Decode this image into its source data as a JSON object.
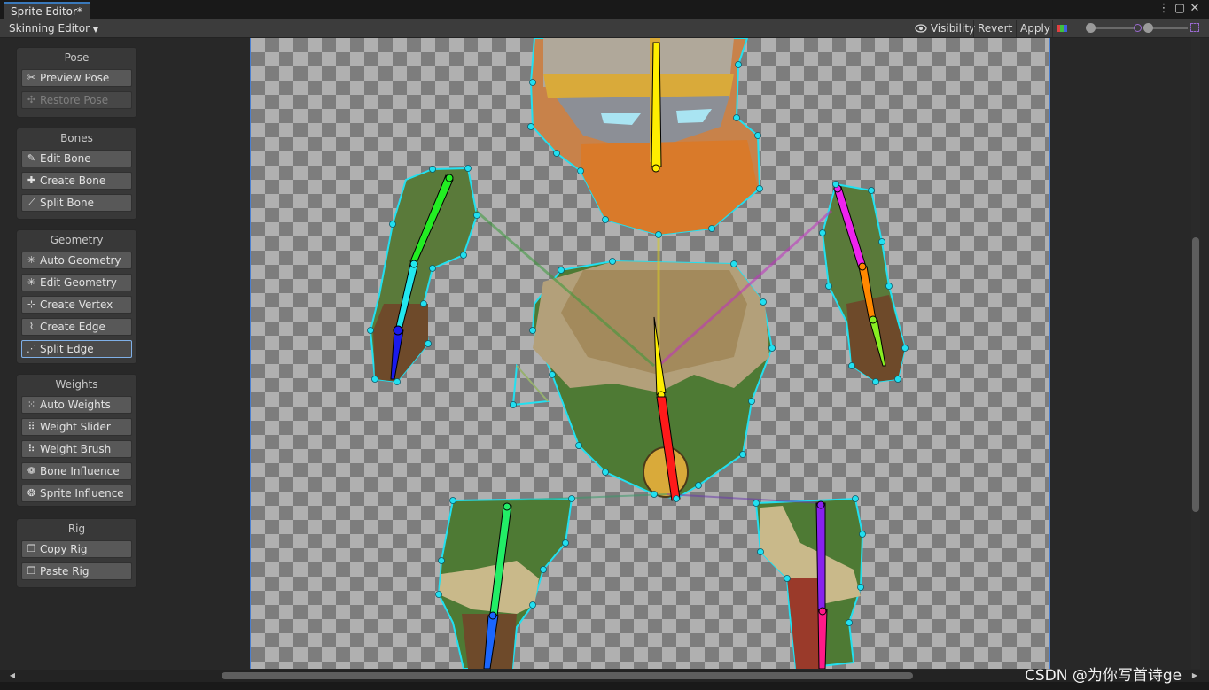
{
  "window": {
    "tab_title": "Sprite Editor*",
    "menu_icon": "kebab-icon",
    "maximize_icon": "maximize-icon",
    "close_icon": "close-icon"
  },
  "toolbar": {
    "mode_dropdown": "Skinning Editor",
    "visibility": "Visibility",
    "revert": "Revert",
    "apply": "Apply"
  },
  "side_panel": {
    "pose": {
      "title": "Pose",
      "buttons": [
        {
          "label": "Preview Pose",
          "icon": "preview-pose-icon",
          "enabled": true
        },
        {
          "label": "Restore Pose",
          "icon": "restore-pose-icon",
          "enabled": false
        }
      ]
    },
    "bones": {
      "title": "Bones",
      "buttons": [
        {
          "label": "Edit Bone",
          "icon": "edit-bone-icon"
        },
        {
          "label": "Create Bone",
          "icon": "create-bone-icon"
        },
        {
          "label": "Split Bone",
          "icon": "split-bone-icon"
        }
      ]
    },
    "geometry": {
      "title": "Geometry",
      "buttons": [
        {
          "label": "Auto Geometry",
          "icon": "auto-geometry-icon"
        },
        {
          "label": "Edit Geometry",
          "icon": "edit-geometry-icon"
        },
        {
          "label": "Create Vertex",
          "icon": "create-vertex-icon"
        },
        {
          "label": "Create Edge",
          "icon": "create-edge-icon"
        },
        {
          "label": "Split Edge",
          "icon": "split-edge-icon",
          "active": true
        }
      ]
    },
    "weights": {
      "title": "Weights",
      "buttons": [
        {
          "label": "Auto Weights",
          "icon": "auto-weights-icon"
        },
        {
          "label": "Weight Slider",
          "icon": "weight-slider-icon"
        },
        {
          "label": "Weight Brush",
          "icon": "weight-brush-icon"
        },
        {
          "label": "Bone Influence",
          "icon": "bone-influence-icon"
        },
        {
          "label": "Sprite Influence",
          "icon": "sprite-influence-icon"
        }
      ]
    },
    "rig": {
      "title": "Rig",
      "buttons": [
        {
          "label": "Copy Rig",
          "icon": "copy-rig-icon"
        },
        {
          "label": "Paste Rig",
          "icon": "paste-rig-icon"
        }
      ]
    }
  },
  "watermark": "CSDN @为你写首诗ge",
  "colors": {
    "mesh_outline": "#22e0f0",
    "bone_head": "#ffee00",
    "bone_torso_lower": "#ff1a1a",
    "bone_left_upper_arm": "#22ee22",
    "bone_left_forearm": "#22e8ee",
    "bone_left_hand": "#1a1aee",
    "bone_right_upper_arm": "#ee22ee",
    "bone_right_forearm": "#ff8800",
    "bone_right_hand": "#88ee22",
    "bone_left_thigh": "#22ee66",
    "bone_left_shin": "#1a66ff",
    "bone_right_thigh": "#8822ee",
    "bone_right_shin": "#ff1a88",
    "accent_active": "#7fb0e8"
  }
}
